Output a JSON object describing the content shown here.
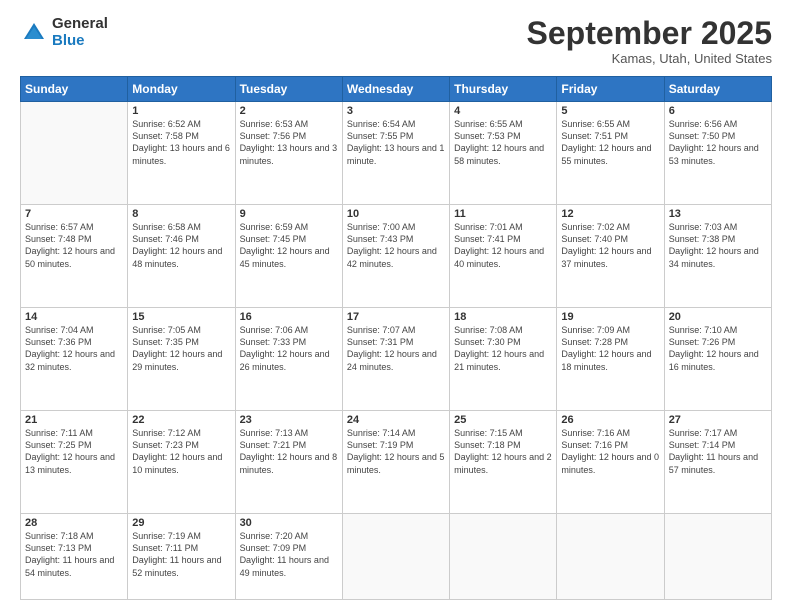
{
  "header": {
    "logo_general": "General",
    "logo_blue": "Blue",
    "month_title": "September 2025",
    "location": "Kamas, Utah, United States"
  },
  "weekdays": [
    "Sunday",
    "Monday",
    "Tuesday",
    "Wednesday",
    "Thursday",
    "Friday",
    "Saturday"
  ],
  "weeks": [
    [
      {
        "day": "",
        "sunrise": "",
        "sunset": "",
        "daylight": ""
      },
      {
        "day": "1",
        "sunrise": "Sunrise: 6:52 AM",
        "sunset": "Sunset: 7:58 PM",
        "daylight": "Daylight: 13 hours and 6 minutes."
      },
      {
        "day": "2",
        "sunrise": "Sunrise: 6:53 AM",
        "sunset": "Sunset: 7:56 PM",
        "daylight": "Daylight: 13 hours and 3 minutes."
      },
      {
        "day": "3",
        "sunrise": "Sunrise: 6:54 AM",
        "sunset": "Sunset: 7:55 PM",
        "daylight": "Daylight: 13 hours and 1 minute."
      },
      {
        "day": "4",
        "sunrise": "Sunrise: 6:55 AM",
        "sunset": "Sunset: 7:53 PM",
        "daylight": "Daylight: 12 hours and 58 minutes."
      },
      {
        "day": "5",
        "sunrise": "Sunrise: 6:55 AM",
        "sunset": "Sunset: 7:51 PM",
        "daylight": "Daylight: 12 hours and 55 minutes."
      },
      {
        "day": "6",
        "sunrise": "Sunrise: 6:56 AM",
        "sunset": "Sunset: 7:50 PM",
        "daylight": "Daylight: 12 hours and 53 minutes."
      }
    ],
    [
      {
        "day": "7",
        "sunrise": "Sunrise: 6:57 AM",
        "sunset": "Sunset: 7:48 PM",
        "daylight": "Daylight: 12 hours and 50 minutes."
      },
      {
        "day": "8",
        "sunrise": "Sunrise: 6:58 AM",
        "sunset": "Sunset: 7:46 PM",
        "daylight": "Daylight: 12 hours and 48 minutes."
      },
      {
        "day": "9",
        "sunrise": "Sunrise: 6:59 AM",
        "sunset": "Sunset: 7:45 PM",
        "daylight": "Daylight: 12 hours and 45 minutes."
      },
      {
        "day": "10",
        "sunrise": "Sunrise: 7:00 AM",
        "sunset": "Sunset: 7:43 PM",
        "daylight": "Daylight: 12 hours and 42 minutes."
      },
      {
        "day": "11",
        "sunrise": "Sunrise: 7:01 AM",
        "sunset": "Sunset: 7:41 PM",
        "daylight": "Daylight: 12 hours and 40 minutes."
      },
      {
        "day": "12",
        "sunrise": "Sunrise: 7:02 AM",
        "sunset": "Sunset: 7:40 PM",
        "daylight": "Daylight: 12 hours and 37 minutes."
      },
      {
        "day": "13",
        "sunrise": "Sunrise: 7:03 AM",
        "sunset": "Sunset: 7:38 PM",
        "daylight": "Daylight: 12 hours and 34 minutes."
      }
    ],
    [
      {
        "day": "14",
        "sunrise": "Sunrise: 7:04 AM",
        "sunset": "Sunset: 7:36 PM",
        "daylight": "Daylight: 12 hours and 32 minutes."
      },
      {
        "day": "15",
        "sunrise": "Sunrise: 7:05 AM",
        "sunset": "Sunset: 7:35 PM",
        "daylight": "Daylight: 12 hours and 29 minutes."
      },
      {
        "day": "16",
        "sunrise": "Sunrise: 7:06 AM",
        "sunset": "Sunset: 7:33 PM",
        "daylight": "Daylight: 12 hours and 26 minutes."
      },
      {
        "day": "17",
        "sunrise": "Sunrise: 7:07 AM",
        "sunset": "Sunset: 7:31 PM",
        "daylight": "Daylight: 12 hours and 24 minutes."
      },
      {
        "day": "18",
        "sunrise": "Sunrise: 7:08 AM",
        "sunset": "Sunset: 7:30 PM",
        "daylight": "Daylight: 12 hours and 21 minutes."
      },
      {
        "day": "19",
        "sunrise": "Sunrise: 7:09 AM",
        "sunset": "Sunset: 7:28 PM",
        "daylight": "Daylight: 12 hours and 18 minutes."
      },
      {
        "day": "20",
        "sunrise": "Sunrise: 7:10 AM",
        "sunset": "Sunset: 7:26 PM",
        "daylight": "Daylight: 12 hours and 16 minutes."
      }
    ],
    [
      {
        "day": "21",
        "sunrise": "Sunrise: 7:11 AM",
        "sunset": "Sunset: 7:25 PM",
        "daylight": "Daylight: 12 hours and 13 minutes."
      },
      {
        "day": "22",
        "sunrise": "Sunrise: 7:12 AM",
        "sunset": "Sunset: 7:23 PM",
        "daylight": "Daylight: 12 hours and 10 minutes."
      },
      {
        "day": "23",
        "sunrise": "Sunrise: 7:13 AM",
        "sunset": "Sunset: 7:21 PM",
        "daylight": "Daylight: 12 hours and 8 minutes."
      },
      {
        "day": "24",
        "sunrise": "Sunrise: 7:14 AM",
        "sunset": "Sunset: 7:19 PM",
        "daylight": "Daylight: 12 hours and 5 minutes."
      },
      {
        "day": "25",
        "sunrise": "Sunrise: 7:15 AM",
        "sunset": "Sunset: 7:18 PM",
        "daylight": "Daylight: 12 hours and 2 minutes."
      },
      {
        "day": "26",
        "sunrise": "Sunrise: 7:16 AM",
        "sunset": "Sunset: 7:16 PM",
        "daylight": "Daylight: 12 hours and 0 minutes."
      },
      {
        "day": "27",
        "sunrise": "Sunrise: 7:17 AM",
        "sunset": "Sunset: 7:14 PM",
        "daylight": "Daylight: 11 hours and 57 minutes."
      }
    ],
    [
      {
        "day": "28",
        "sunrise": "Sunrise: 7:18 AM",
        "sunset": "Sunset: 7:13 PM",
        "daylight": "Daylight: 11 hours and 54 minutes."
      },
      {
        "day": "29",
        "sunrise": "Sunrise: 7:19 AM",
        "sunset": "Sunset: 7:11 PM",
        "daylight": "Daylight: 11 hours and 52 minutes."
      },
      {
        "day": "30",
        "sunrise": "Sunrise: 7:20 AM",
        "sunset": "Sunset: 7:09 PM",
        "daylight": "Daylight: 11 hours and 49 minutes."
      },
      {
        "day": "",
        "sunrise": "",
        "sunset": "",
        "daylight": ""
      },
      {
        "day": "",
        "sunrise": "",
        "sunset": "",
        "daylight": ""
      },
      {
        "day": "",
        "sunrise": "",
        "sunset": "",
        "daylight": ""
      },
      {
        "day": "",
        "sunrise": "",
        "sunset": "",
        "daylight": ""
      }
    ]
  ]
}
